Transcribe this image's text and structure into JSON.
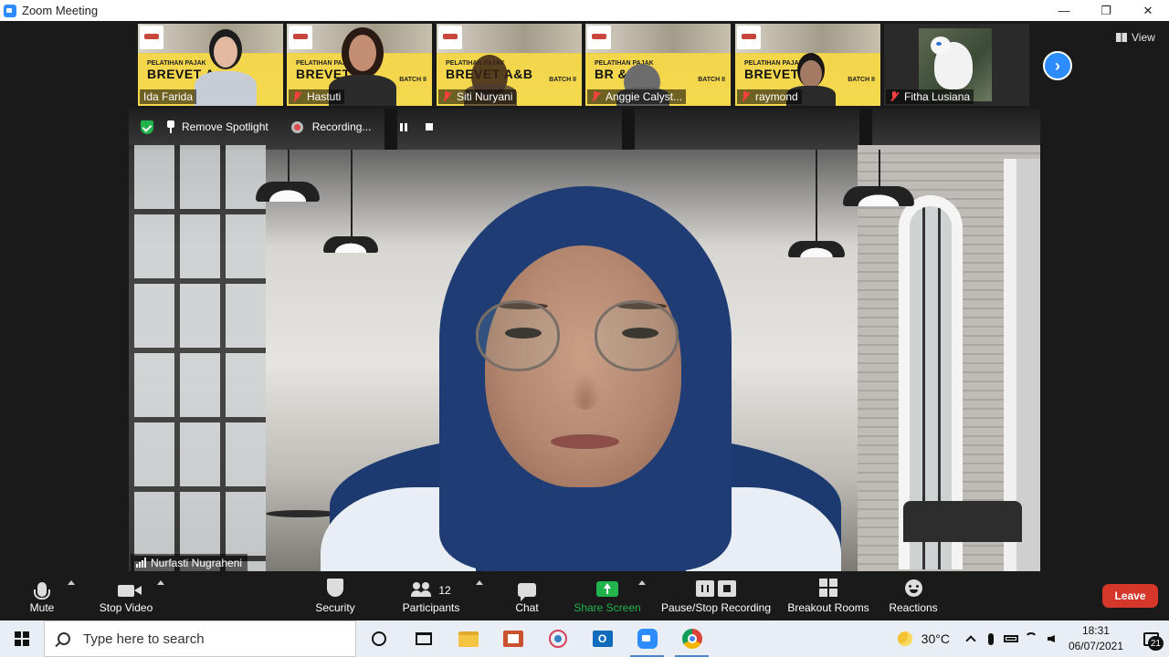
{
  "window": {
    "title": "Zoom Meeting",
    "minimize": "—",
    "restore": "❐",
    "close": "✕"
  },
  "view": {
    "label": "View"
  },
  "thumbnails": [
    {
      "name": "Ida Farida",
      "muted": false,
      "poster_small": "PELATIHAN PAJAK",
      "poster_big": "BREVET A",
      "poster_batch": ""
    },
    {
      "name": "Hastuti",
      "muted": true,
      "poster_small": "PELATIHAN PAJAK",
      "poster_big": "BREVET",
      "poster_batch": "BATCH II"
    },
    {
      "name": "Siti Nuryani",
      "muted": true,
      "poster_small": "PELATIHAN PAJAK",
      "poster_big": "BREVET A&B",
      "poster_batch": "BATCH II"
    },
    {
      "name": "Anggie Calyst...",
      "muted": true,
      "poster_small": "PELATIHAN PAJAK",
      "poster_big": "BR    &B",
      "poster_batch": "BATCH II"
    },
    {
      "name": "raymond",
      "muted": true,
      "poster_small": "PELATIHAN PAJAK",
      "poster_big": "BREVET",
      "poster_batch": "BATCH II"
    },
    {
      "name": "Fitha Lusiana",
      "muted": true
    }
  ],
  "spotlight_bar": {
    "remove_spotlight": "Remove Spotlight",
    "recording": "Recording..."
  },
  "main_video": {
    "name": "Nurfasti Nugraheni"
  },
  "toolbar": {
    "mute": "Mute",
    "stop_video": "Stop Video",
    "security": "Security",
    "participants": "Participants",
    "participant_count": "12",
    "chat": "Chat",
    "share_screen": "Share Screen",
    "pause_stop_recording": "Pause/Stop Recording",
    "breakout_rooms": "Breakout Rooms",
    "reactions": "Reactions",
    "leave": "Leave"
  },
  "taskbar": {
    "search_placeholder": "Type here to search",
    "outlook_letter": "O",
    "temperature": "30°C",
    "time": "18:31",
    "date": "06/07/2021",
    "notification_count": "21"
  },
  "colors": {
    "zoom_blue": "#2d8cff",
    "share_green": "#21b34c",
    "leave_red": "#d5372b",
    "bg_dark": "#1a1a1a"
  }
}
